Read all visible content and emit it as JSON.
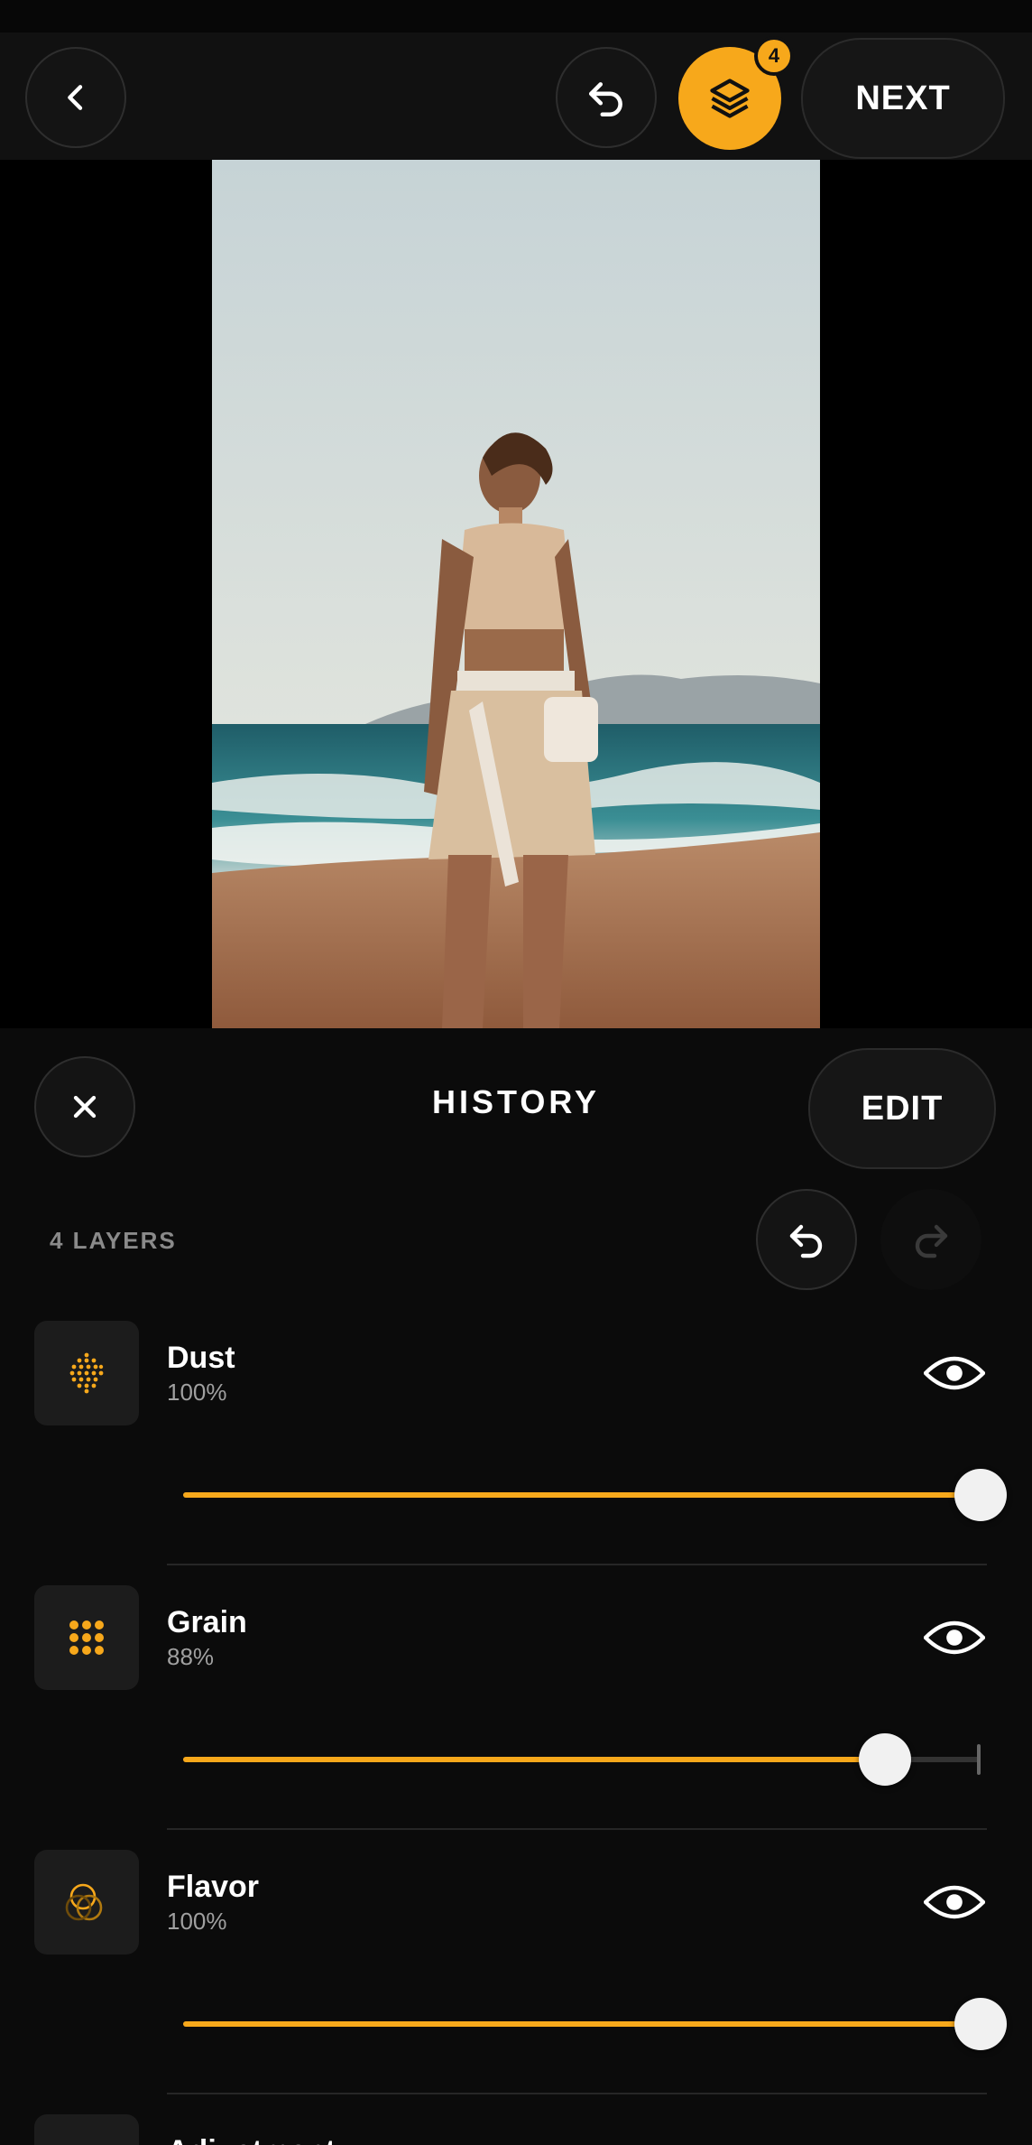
{
  "colors": {
    "accent": "#f7a81b",
    "background": "#0b0b0b"
  },
  "header": {
    "back_icon": "chevron-left-icon",
    "undo_icon": "undo-icon",
    "layers_icon": "layers-icon",
    "layers_badge": "4",
    "next_label": "NEXT"
  },
  "panel": {
    "close_icon": "close-icon",
    "title": "HISTORY",
    "edit_label": "EDIT",
    "layers_count": "4 LAYERS",
    "undo_icon": "undo-icon",
    "redo_icon": "redo-icon"
  },
  "layers": [
    {
      "name": "Dust",
      "percent_label": "100%",
      "value": 1.0,
      "icon": "dust-dots-icon"
    },
    {
      "name": "Grain",
      "percent_label": "88%",
      "value": 0.88,
      "icon": "grain-grid-icon"
    },
    {
      "name": "Flavor",
      "percent_label": "100%",
      "value": 1.0,
      "icon": "flavor-circles-icon"
    },
    {
      "name": "Adjustment",
      "icon": "adjustment-icon"
    }
  ]
}
